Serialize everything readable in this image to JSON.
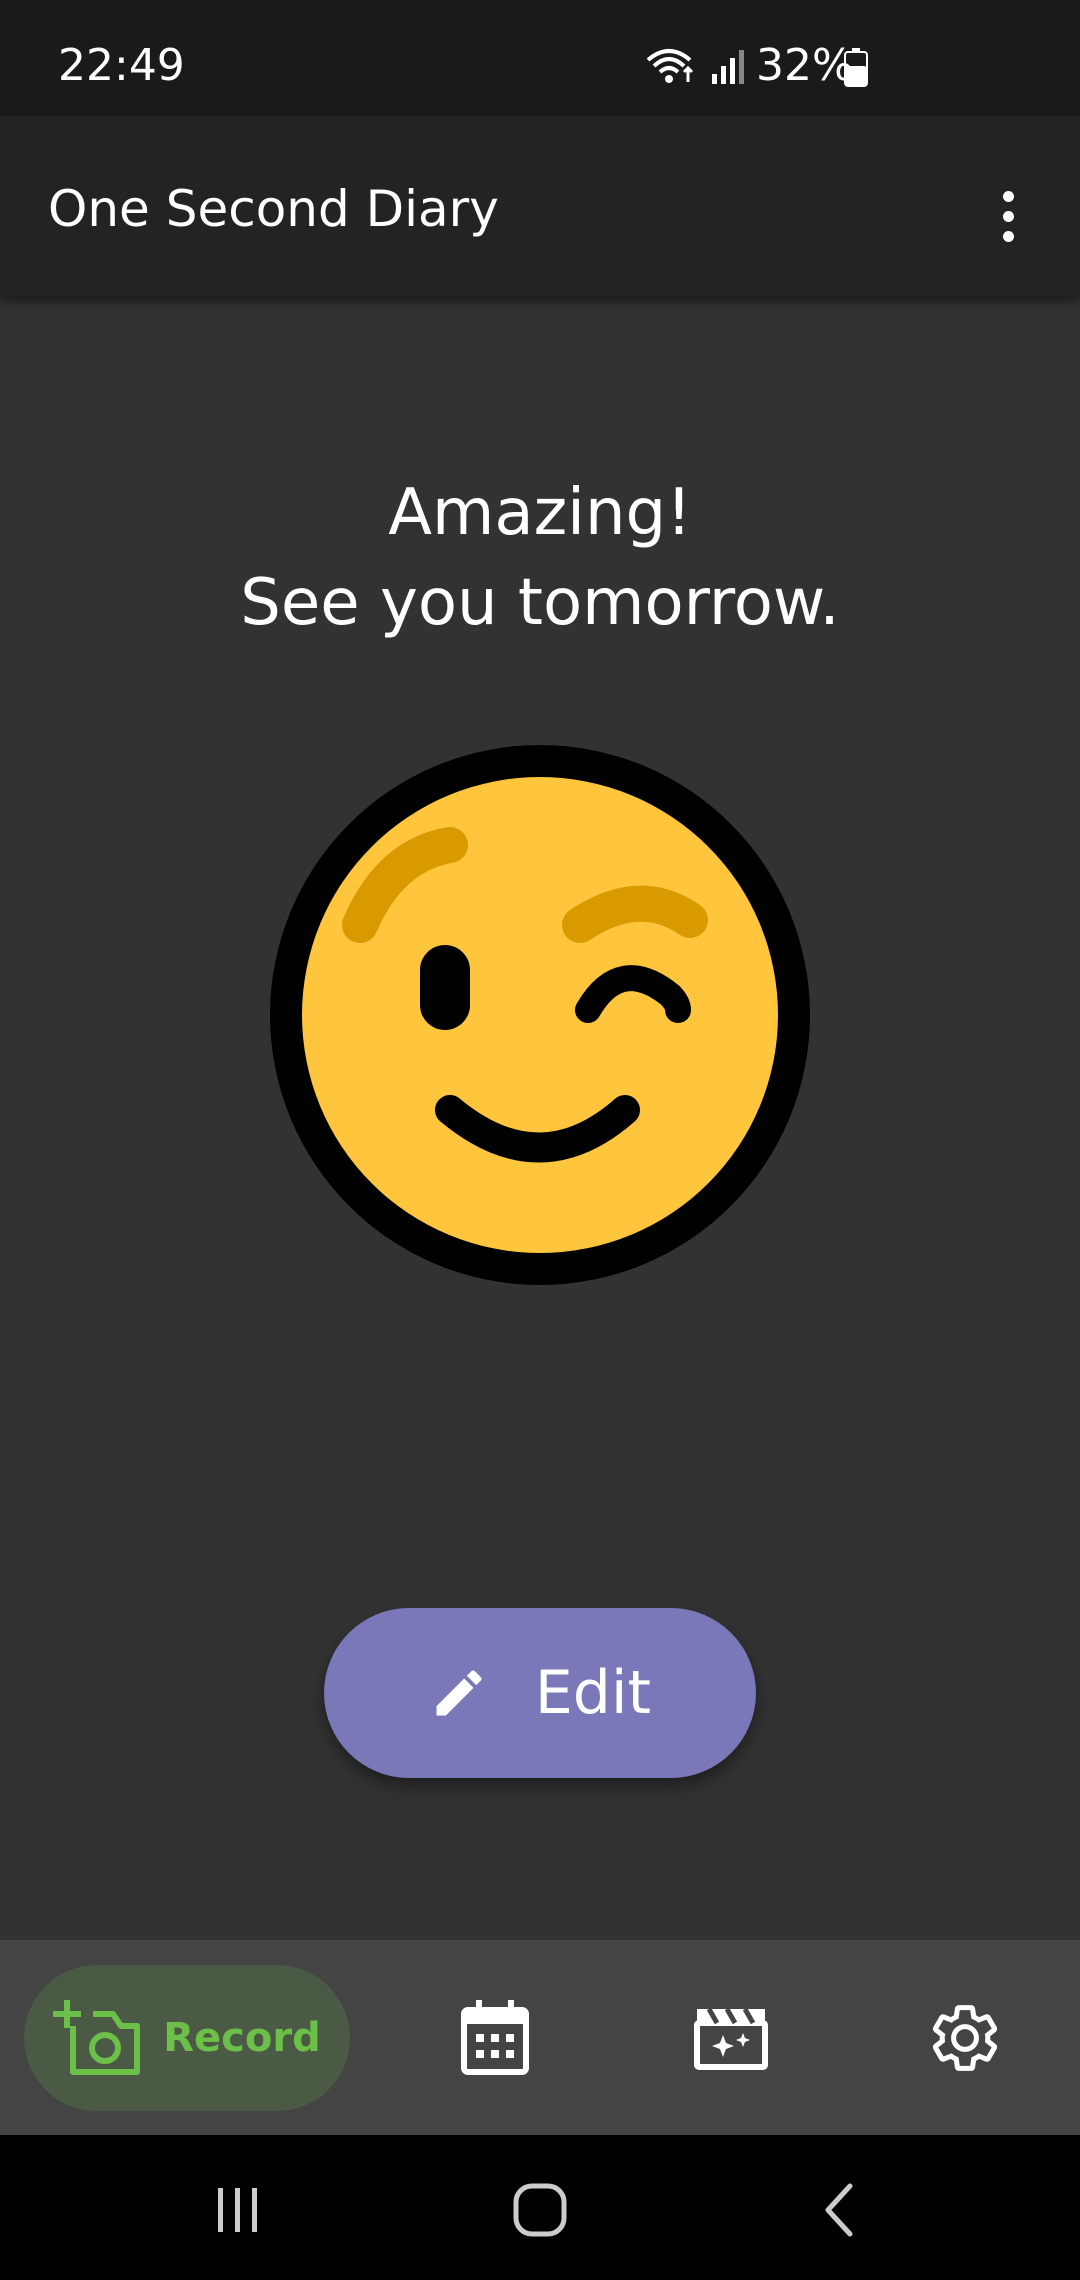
{
  "status_bar": {
    "time": "22:49",
    "battery": "32%",
    "icons": [
      "wifi-icon",
      "signal-icon",
      "battery-icon"
    ]
  },
  "app_bar": {
    "title": "One Second Diary",
    "menu_icon": "more-vert-icon"
  },
  "main": {
    "message_line1": "Amazing!",
    "message_line2": "See you tomorrow.",
    "emoji": "winking-face-emoji",
    "edit_button": {
      "label": "Edit",
      "icon": "pencil-icon"
    }
  },
  "bottom_nav": {
    "items": [
      {
        "label": "Record",
        "icon": "add-camera-icon",
        "selected": true
      },
      {
        "icon": "calendar-icon"
      },
      {
        "icon": "movie-sparkle-icon"
      },
      {
        "icon": "settings-icon"
      }
    ]
  },
  "system_nav": {
    "icons": [
      "recent-apps-icon",
      "home-icon",
      "back-icon"
    ]
  },
  "colors": {
    "background": "#323232",
    "app_bar": "#232323",
    "status_bar": "#1a1a1a",
    "edit_button": "#7a78b9",
    "bottom_nav": "#444444",
    "record_active_bg": "#4b5a44",
    "record_active_fg": "#6cc04a",
    "emoji_face": "#fec53d",
    "emoji_brow": "#d99a00"
  }
}
